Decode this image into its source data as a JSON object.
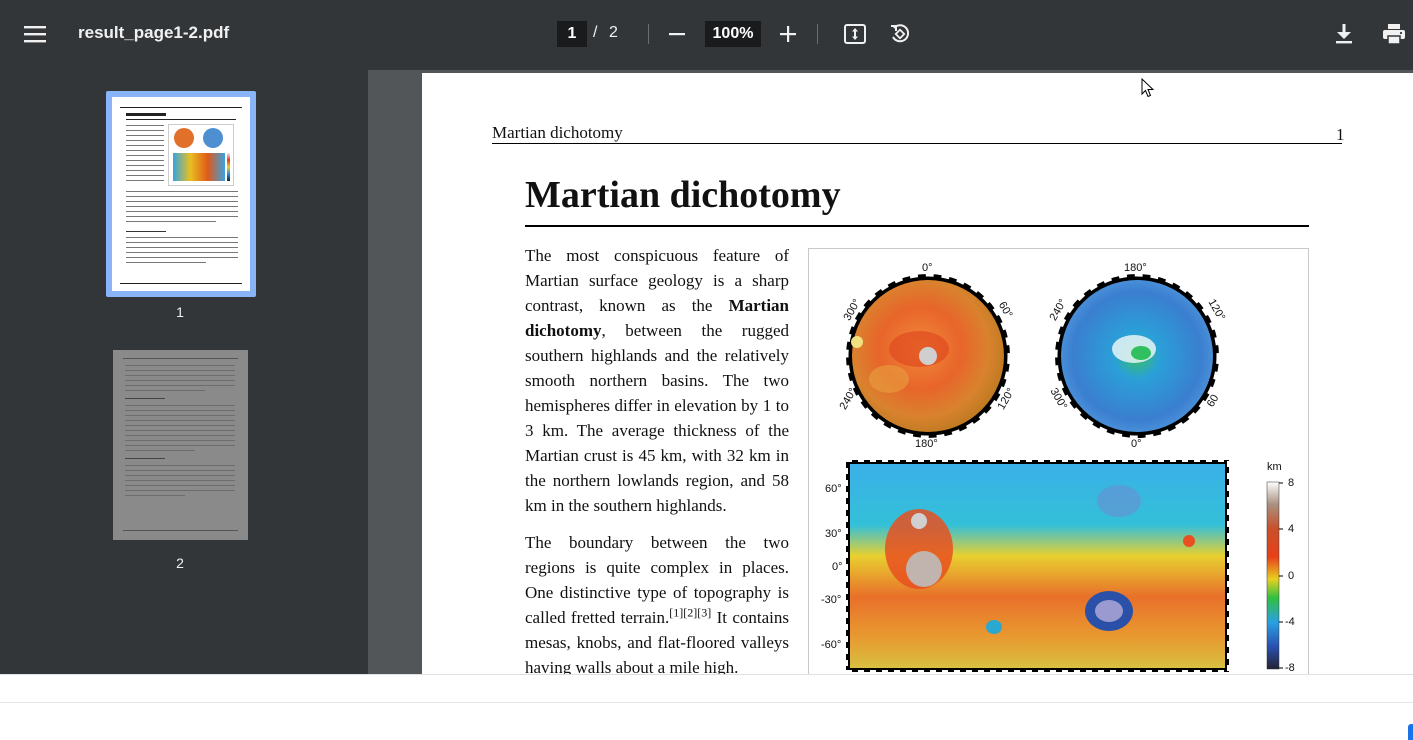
{
  "toolbar": {
    "menu_icon": "hamburger-menu-icon",
    "file_name": "result_page1-2.pdf",
    "current_page": "1",
    "page_separator": "/",
    "total_pages": "2",
    "zoom": "100%",
    "icons": [
      "minus-icon",
      "plus-icon",
      "fit-page-icon",
      "rotate-icon",
      "download-icon",
      "print-icon"
    ]
  },
  "sidebar": {
    "thumbnails": [
      {
        "label": "1",
        "selected": true
      },
      {
        "label": "2",
        "selected": false
      }
    ],
    "selected_color": "#8ab4f8"
  },
  "document": {
    "running_head": "Martian dichotomy",
    "page_number": "1",
    "title": "Martian dichotomy",
    "para1_a": "The most conspicuous feature of Martian surface geology is a sharp contrast, known as the ",
    "para1_bold": "Martian dichotomy",
    "para1_b": ", between the rugged southern highlands and the relatively smooth northern basins. The two hemispheres differ in elevation by 1 to 3 km. The average thickness of the Martian crust is 45 km, with 32 km in the northern lowlands region, and 58 km in the southern highlands.",
    "para2_a": "The boundary between the two regions is quite complex in places. One distinctive type of topography is called fretted terrain.",
    "para2_sup": "[1][2][3]",
    "para2_b": " It contains mesas, knobs, and flat-floored valleys having walls about a mile high.",
    "figure": {
      "globe1_labels": {
        "top": "0°",
        "left": "300°",
        "right": "60°",
        "lower_left": "240°",
        "lower_right": "120°",
        "bottom": "180°"
      },
      "globe2_labels": {
        "top": "180°",
        "left": "240°",
        "right": "120°",
        "lower_left": "300°",
        "lower_right": "60",
        "bottom": "0°"
      },
      "map_lat_labels": [
        "60°",
        "30°",
        "0°",
        "-30°",
        "-60°"
      ],
      "colorbar_unit": "km",
      "colorbar_ticks": [
        "8",
        "4",
        "0",
        "-4",
        "-8"
      ]
    }
  }
}
